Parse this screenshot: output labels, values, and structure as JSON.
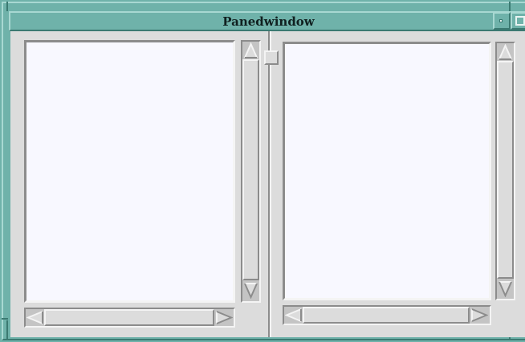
{
  "window": {
    "title": "Panedwindow"
  },
  "icons": {
    "window_menu": "window-menu-icon",
    "minimize": "minimize-icon",
    "maximize": "maximize-icon",
    "scroll_up": "arrow-up-icon",
    "scroll_down": "arrow-down-icon",
    "scroll_left": "arrow-left-icon",
    "scroll_right": "arrow-right-icon"
  },
  "colors": {
    "frame": "#6fb2aa",
    "background": "#dcdcdc",
    "listbox": "#f8f8ff",
    "trough": "#c4c4c4"
  },
  "panes": {
    "left": {
      "items": []
    },
    "right": {
      "items": []
    }
  }
}
